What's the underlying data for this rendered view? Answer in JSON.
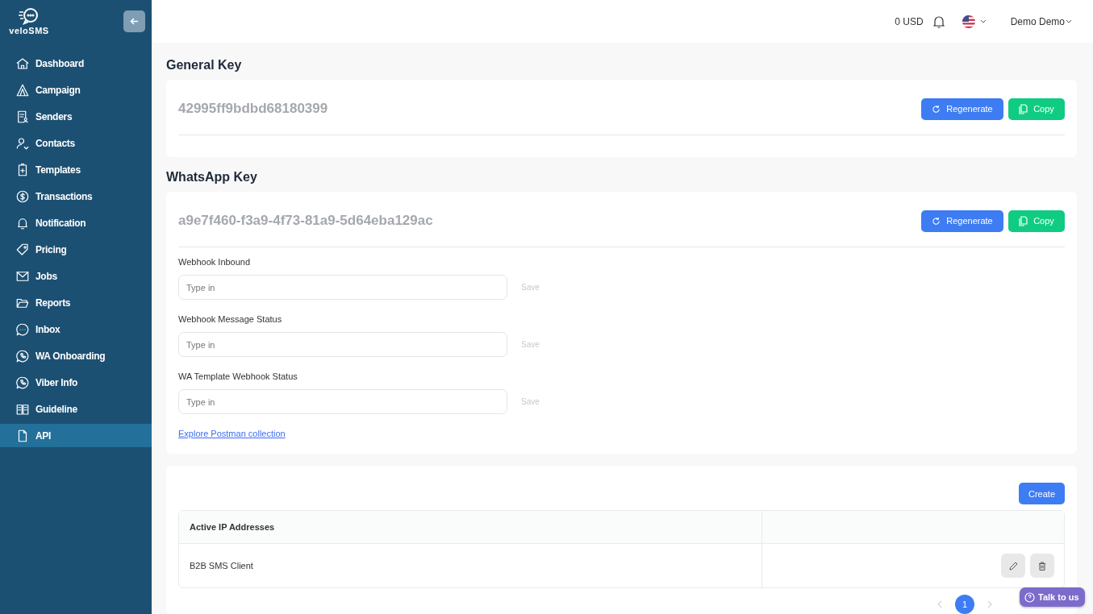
{
  "sidebar": {
    "logo": "veloSMS",
    "items": [
      {
        "label": "Dashboard",
        "selected": false
      },
      {
        "label": "Campaign",
        "selected": false
      },
      {
        "label": "Senders",
        "selected": false
      },
      {
        "label": "Contacts",
        "selected": false
      },
      {
        "label": "Templates",
        "selected": false
      },
      {
        "label": "Transactions",
        "selected": false
      },
      {
        "label": "Notification",
        "selected": false
      },
      {
        "label": "Pricing",
        "selected": false
      },
      {
        "label": "Jobs",
        "selected": false
      },
      {
        "label": "Reports",
        "selected": false
      },
      {
        "label": "Inbox",
        "selected": false
      },
      {
        "label": "WA Onboarding",
        "selected": false
      },
      {
        "label": "Viber Info",
        "selected": false
      },
      {
        "label": "Guideline",
        "selected": false
      },
      {
        "label": "API",
        "selected": true
      }
    ]
  },
  "header": {
    "balance": "0 USD",
    "user": "Demo Demo"
  },
  "general_key": {
    "title": "General Key",
    "key": "42995ff9bdbd68180399",
    "buttons": [
      "Regenerate",
      "Copy"
    ]
  },
  "whatsapp_key": {
    "title": "WhatsApp Key",
    "key": "a9e7f460-f3a9-4f73-81a9-5d64eba129ac",
    "buttons": [
      "Regenerate",
      "Copy"
    ],
    "webhooks": [
      {
        "label": "Webhook Inbound",
        "placeholder": "Type in",
        "action": "Save"
      },
      {
        "label": "Webhook Message Status",
        "placeholder": "Type in",
        "action": "Save"
      },
      {
        "label": "WA Template Webhook Status",
        "placeholder": "Type in",
        "action": "Save"
      }
    ],
    "link": "Explore Postman collection"
  },
  "ip_table": {
    "create": "Create",
    "columns": [
      "Active IP Addresses"
    ],
    "rows": [
      {
        "name": "B2B SMS Client"
      }
    ],
    "pagination": {
      "pages": [
        {
          "label": "1",
          "selected": true
        }
      ]
    }
  },
  "chat_widget": {
    "label": "Talk to us"
  }
}
